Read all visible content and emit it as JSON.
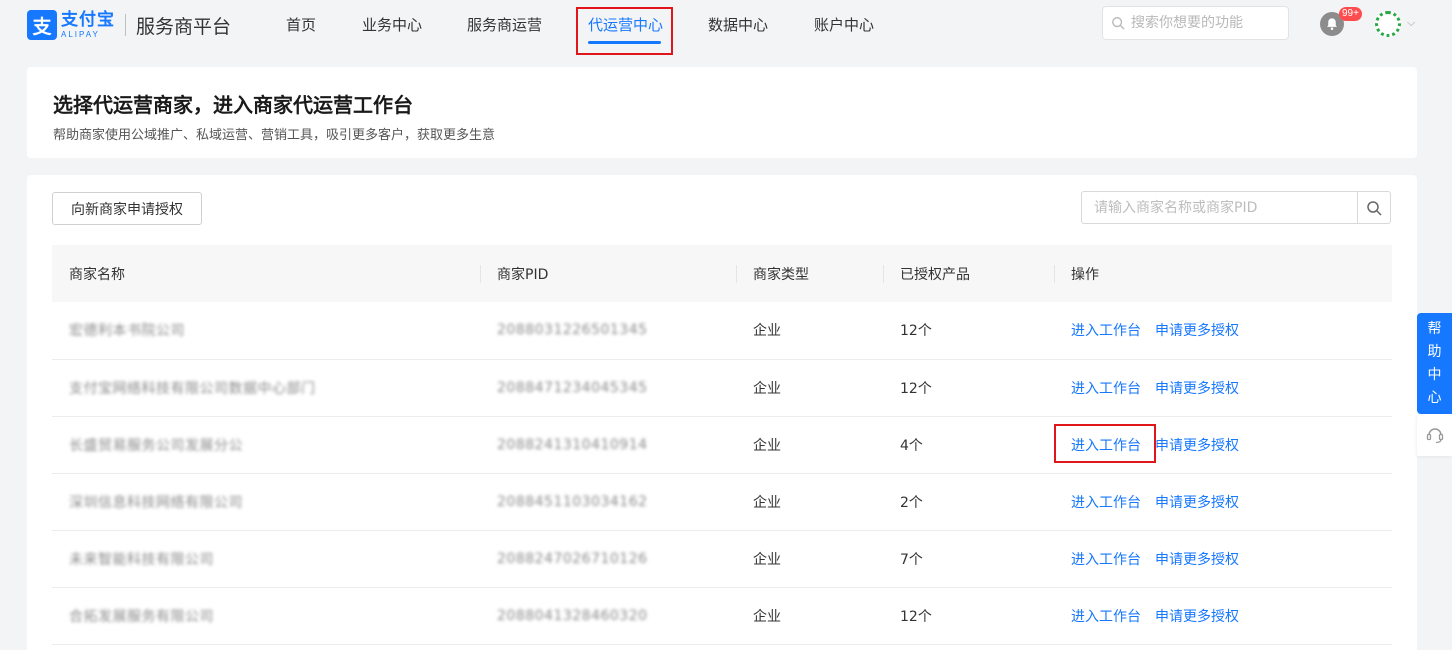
{
  "brand": {
    "logo_cn": "支付宝",
    "logo_en": "ALIPAY",
    "platform": "服务商平台",
    "logo_mark": "支"
  },
  "nav": [
    {
      "label": "首页"
    },
    {
      "label": "业务中心"
    },
    {
      "label": "服务商运营"
    },
    {
      "label": "代运营中心",
      "active": true
    },
    {
      "label": "数据中心"
    },
    {
      "label": "账户中心"
    }
  ],
  "search": {
    "placeholder": "搜索你想要的功能"
  },
  "notifications": {
    "badge": "99+"
  },
  "header": {
    "title": "选择代运营商家，进入商家代运营工作台",
    "subtitle": "帮助商家使用公域推广、私域运营、营销工具，吸引更多客户，获取更多生意"
  },
  "toolbar": {
    "apply_button": "向新商家申请授权",
    "merchant_search_placeholder": "请输入商家名称或商家PID"
  },
  "table": {
    "columns": [
      "商家名称",
      "商家PID",
      "商家类型",
      "已授权产品",
      "操作"
    ],
    "rows": [
      {
        "name": "宏德利本书院公司",
        "pid": "2088031226501345",
        "type": "企业",
        "products": "12个",
        "action1": "进入工作台",
        "action2": "申请更多授权"
      },
      {
        "name": "支付宝网络科技有限公司数据中心部门",
        "pid": "2088471234045345",
        "type": "企业",
        "products": "12个",
        "action1": "进入工作台",
        "action2": "申请更多授权"
      },
      {
        "name": "长盛贸易服务公司发展分公",
        "pid": "2088241310410914",
        "type": "企业",
        "products": "4个",
        "action1": "进入工作台",
        "action2": "申请更多授权"
      },
      {
        "name": "深圳信息科技网络有限公司",
        "pid": "2088451103034162",
        "type": "企业",
        "products": "2个",
        "action1": "进入工作台",
        "action2": "申请更多授权"
      },
      {
        "name": "未来智能科技有限公司",
        "pid": "2088247026710126",
        "type": "企业",
        "products": "7个",
        "action1": "进入工作台",
        "action2": "申请更多授权"
      },
      {
        "name": "合拓发展服务有限公司",
        "pid": "2088041328460320",
        "type": "企业",
        "products": "12个",
        "action1": "进入工作台",
        "action2": "申请更多授权"
      }
    ]
  },
  "help": {
    "label_chars": [
      "帮",
      "助",
      "中",
      "心"
    ]
  },
  "colors": {
    "accent": "#1677ff",
    "highlight": "#e0161b",
    "badge": "#ff4d4f"
  }
}
